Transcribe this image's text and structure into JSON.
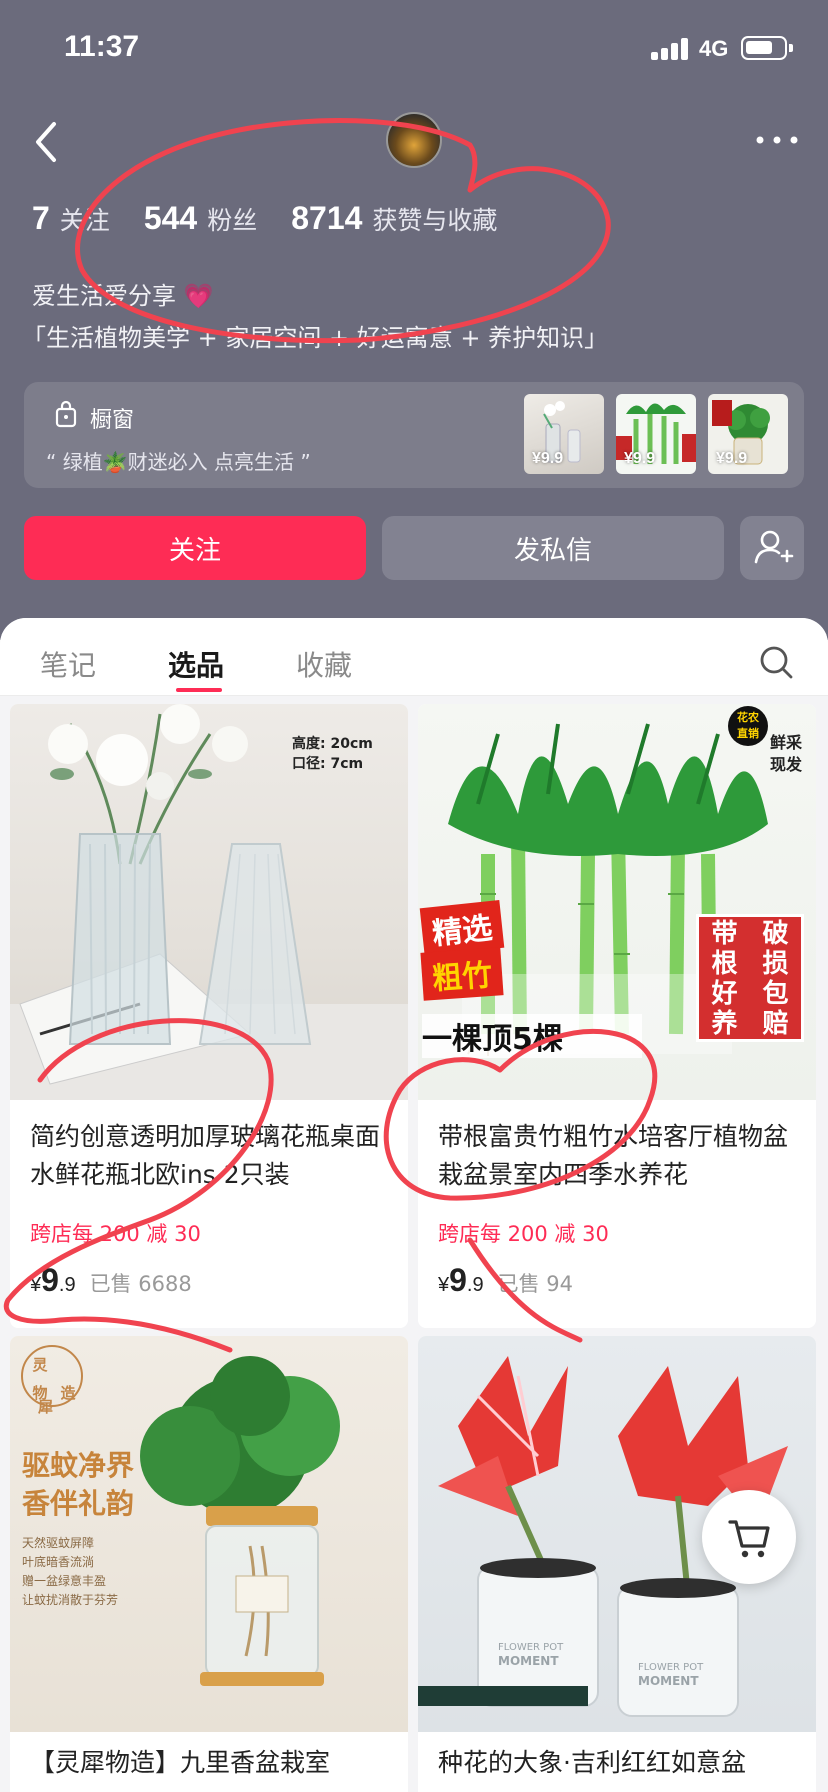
{
  "status_bar": {
    "time": "11:37",
    "network": "4G",
    "battery_level": 0.75
  },
  "profile": {
    "stats": [
      {
        "num": "7",
        "label": "关注"
      },
      {
        "num": "544",
        "label": "粉丝"
      },
      {
        "num": "8714",
        "label": "获赞与收藏"
      }
    ],
    "bio_line1": "爱生活爱分享 💗",
    "bio_line2": "「生活植物美学 + 家居空间 + 好运寓意 + 养护知识」"
  },
  "shop": {
    "title": "橱窗",
    "subtitle": "“ 绿植🪴财迷必入 点亮生活 ”",
    "thumb_prices": [
      "¥9.9",
      "¥9.9",
      "¥9.9"
    ]
  },
  "actions": {
    "follow": "关注",
    "message": "发私信"
  },
  "tabs": [
    {
      "label": "笔记",
      "active": false
    },
    {
      "label": "选品",
      "active": true
    },
    {
      "label": "收藏",
      "active": false
    }
  ],
  "products": [
    {
      "title": "简约创意透明加厚玻璃花瓶桌面水鲜花瓶北欧ins 2只装",
      "promo": "跨店每 200 减 30",
      "price_symbol": "¥",
      "price_int": "9",
      "price_dec": ".9",
      "sold": "已售 6688",
      "overlay_lines": [
        "高度: 20cm",
        "口径: 7cm"
      ]
    },
    {
      "title": "带根富贵竹粗竹水培客厅植物盆栽盆景室内四季水养花",
      "promo": "跨店每 200 减 30",
      "price_symbol": "¥",
      "price_int": "9",
      "price_dec": ".9",
      "sold": "已售 94",
      "overlay": {
        "badge1": "花农",
        "badge2": "直销",
        "fresh": "鲜采",
        "now": "现发",
        "tag1": "精选",
        "tag2": "粗竹",
        "bottom": "一棵顶5棵",
        "right": [
          "带",
          "破",
          "根",
          "损",
          "好",
          "包",
          "养",
          "赔"
        ]
      }
    },
    {
      "title": "【灵犀物造】九里香盆栽室",
      "overlay": {
        "brand": [
          "灵",
          "物",
          "造",
          "犀"
        ],
        "head1": "驱蚊净界",
        "head2": "香伴礼韵",
        "lines": [
          "天然驱蚊屏障",
          "叶底暗香流淌",
          "赠一盆绿意丰盈",
          "让蚊扰消散于芬芳"
        ]
      }
    },
    {
      "title": "种花的大象·吉利红红如意盆",
      "overlay": {
        "pot_text1": "FLOWER POT",
        "pot_text2": "MOMENT"
      }
    }
  ],
  "colors": {
    "hero_bg": "#6b6b7c",
    "accent": "#fe2c55",
    "annotation": "#f0434f"
  }
}
